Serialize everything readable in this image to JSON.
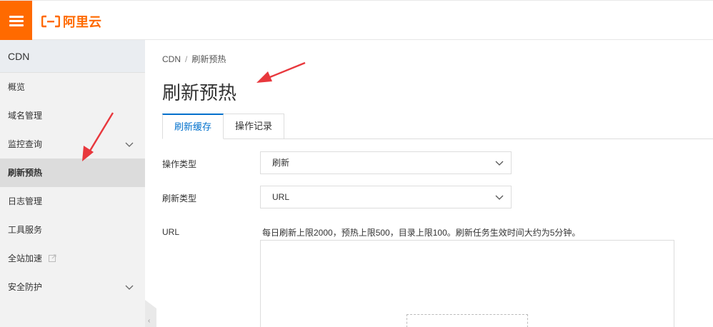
{
  "header": {
    "logo_text": "阿里云",
    "brand_color": "#ff6a00"
  },
  "sidebar": {
    "title": "CDN",
    "items": [
      {
        "label": "概览"
      },
      {
        "label": "域名管理"
      },
      {
        "label": "监控查询"
      },
      {
        "label": "刷新预热"
      },
      {
        "label": "日志管理"
      },
      {
        "label": "工具服务"
      },
      {
        "label": "全站加速"
      },
      {
        "label": "安全防护"
      }
    ]
  },
  "breadcrumb": {
    "root": "CDN",
    "separator": "/",
    "current": "刷新预热"
  },
  "page": {
    "title": "刷新预热"
  },
  "tabs": [
    {
      "label": "刷新缓存"
    },
    {
      "label": "操作记录"
    }
  ],
  "form": {
    "operation_type_label": "操作类型",
    "operation_type_value": "刷新",
    "refresh_type_label": "刷新类型",
    "refresh_type_value": "URL",
    "url_label": "URL",
    "url_hint": "每日刷新上限2000，预热上限500，目录上限100。刷新任务生效时间大约为5分钟。"
  },
  "colors": {
    "accent": "#0070cc",
    "annotation": "#e8383d"
  }
}
